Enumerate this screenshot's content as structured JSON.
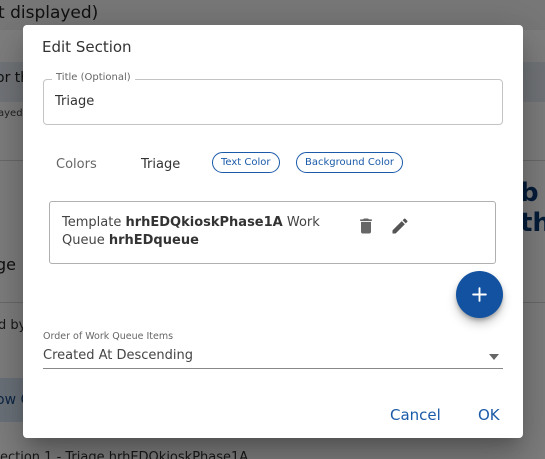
{
  "background": {
    "title_fragment": "t displayed)",
    "strip_fragment": "or th",
    "small_fragment": "ayed",
    "label_fragment": "ge",
    "side_fragment": "b\nth",
    "small2_fragment": "d by",
    "blue_fragment": "ow C",
    "bottom_fragment": "ection 1 - Triage hrhEDQkioskPhase1A"
  },
  "dialog": {
    "title": "Edit Section",
    "title_field": {
      "legend": "Title (Optional)",
      "value": "Triage"
    },
    "colors_label": "Colors",
    "section_name": "Triage",
    "chips": {
      "text_color": "Text Color",
      "background_color": "Background Color"
    },
    "template_card": {
      "prefix_template": "Template ",
      "template_name": "hrhEDQkioskPhase1A",
      "prefix_queue": " Work Queue ",
      "queue_name": "hrhEDqueue"
    },
    "order": {
      "label": "Order of Work Queue Items",
      "value": "Created At Descending"
    },
    "buttons": {
      "cancel": "Cancel",
      "ok": "OK"
    }
  },
  "colors": {
    "accent": "#1a5aa8",
    "fab": "#1252a0",
    "overlay": "rgba(0,0,0,0.5)"
  },
  "icons": {
    "trash": "trash-icon",
    "edit": "pencil-icon",
    "add": "plus-icon",
    "dropdown": "chevron-down-icon"
  }
}
